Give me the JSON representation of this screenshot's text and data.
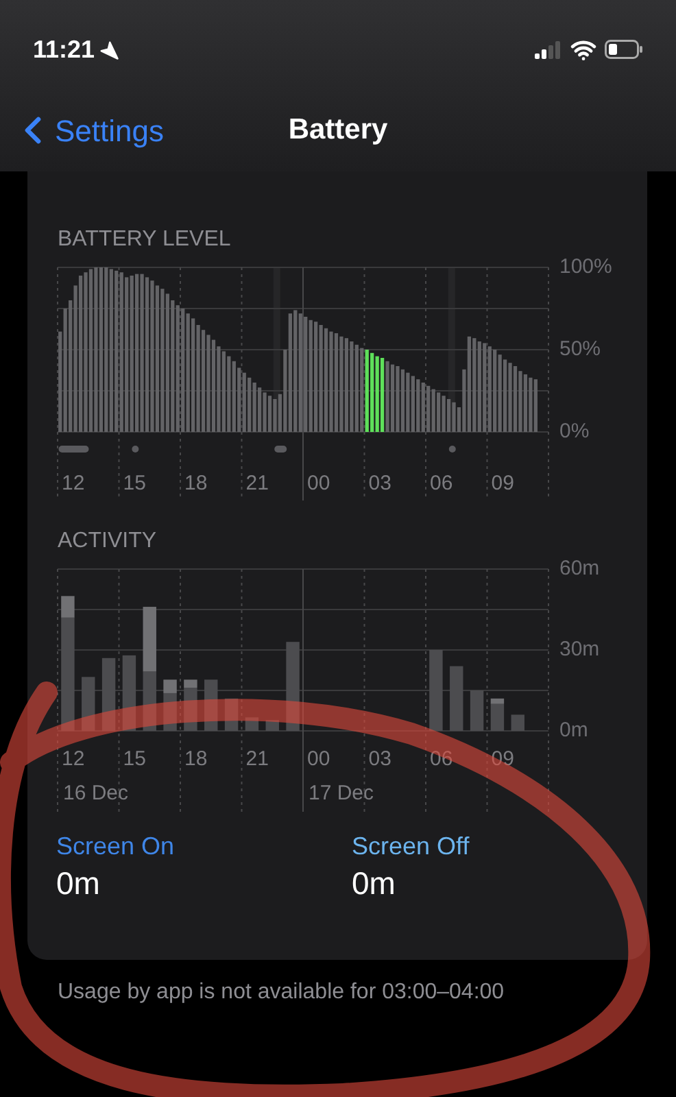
{
  "status_bar": {
    "time": "11:21"
  },
  "nav": {
    "back": "Settings",
    "title": "Battery"
  },
  "battery_chart": {
    "chart_data": {
      "type": "bar",
      "title": "BATTERY LEVEL",
      "ylim": [
        0,
        100
      ],
      "categories": [
        null,
        null,
        null,
        "12",
        null,
        null,
        null,
        null,
        null,
        null,
        null,
        null,
        null,
        null,
        null,
        "15",
        null,
        null,
        null,
        null,
        null,
        null,
        null,
        null,
        null,
        null,
        null,
        "18",
        null,
        null,
        null,
        null,
        null,
        null,
        null,
        null,
        null,
        null,
        null,
        "21",
        null,
        null,
        null,
        null,
        null,
        null,
        null,
        null,
        null,
        null,
        null,
        "00",
        null,
        null,
        null,
        null,
        null,
        null,
        null,
        null,
        null,
        null,
        null,
        "03",
        null,
        null,
        null,
        null,
        null,
        null,
        null,
        null,
        null,
        null,
        null,
        "06",
        null,
        null,
        null,
        null,
        null,
        null,
        null,
        null,
        null,
        null,
        null,
        "09",
        null,
        null,
        null,
        null,
        null,
        null,
        null,
        null
      ],
      "series": [
        {
          "color": "#636366",
          "values": [
            61,
            75,
            80,
            89,
            95,
            97,
            99,
            100,
            100,
            100,
            99,
            98,
            97,
            94,
            95,
            96,
            96,
            94,
            92,
            89,
            87,
            84,
            80,
            77,
            75,
            72,
            69,
            65,
            62,
            59,
            56,
            52,
            49,
            46,
            43,
            39,
            36,
            33,
            30,
            27,
            24,
            22,
            20,
            23,
            50,
            72,
            74,
            72,
            70,
            68,
            67,
            65,
            63,
            61,
            60,
            58,
            57,
            55,
            53,
            51,
            null,
            null,
            null,
            null,
            43,
            41,
            40,
            38,
            36,
            34,
            32,
            30,
            28,
            26,
            24,
            22,
            20,
            18,
            15,
            38,
            58,
            57,
            55,
            54,
            52,
            50,
            47,
            44,
            42,
            40,
            37,
            35,
            33,
            32,
            null,
            null
          ]
        },
        {
          "color": "#5ee05a",
          "values": [
            null,
            null,
            null,
            null,
            null,
            null,
            null,
            null,
            null,
            null,
            null,
            null,
            null,
            null,
            null,
            null,
            null,
            null,
            null,
            null,
            null,
            null,
            null,
            null,
            null,
            null,
            null,
            null,
            null,
            null,
            null,
            null,
            null,
            null,
            null,
            null,
            null,
            null,
            null,
            null,
            null,
            null,
            null,
            null,
            null,
            null,
            null,
            null,
            null,
            null,
            null,
            null,
            null,
            null,
            null,
            null,
            null,
            null,
            null,
            null,
            50,
            48,
            46,
            45,
            null,
            null,
            null,
            null,
            null,
            null,
            null,
            null,
            null,
            null,
            null,
            null,
            null,
            null,
            null,
            null,
            null,
            null,
            null,
            null,
            null,
            null,
            null,
            null,
            null,
            null,
            null,
            null,
            null,
            null,
            null,
            null
          ]
        }
      ],
      "yticks": [
        {
          "value": 0,
          "label": "0%"
        },
        {
          "value": 50,
          "label": "50%"
        },
        {
          "value": 100,
          "label": "100%"
        }
      ]
    }
  },
  "activity_chart": {
    "chart_data": {
      "type": "bar",
      "title": "ACTIVITY",
      "stacked": true,
      "ylim": [
        0,
        60
      ],
      "categories": [
        "12",
        null,
        null,
        "15",
        null,
        null,
        "18",
        null,
        null,
        "21",
        null,
        null,
        "00",
        null,
        null,
        "03",
        null,
        null,
        "06",
        null,
        null,
        "09",
        null,
        null
      ],
      "series": [
        {
          "name": "Screen On",
          "color": "#4c4c4f",
          "values": [
            42,
            20,
            27,
            28,
            22,
            14,
            16,
            19,
            12,
            5,
            4,
            33,
            0,
            0,
            0,
            0,
            0,
            0,
            30,
            24,
            15,
            10,
            6,
            0
          ]
        },
        {
          "name": "Screen Off",
          "color": "#717174",
          "values": [
            8,
            0,
            0,
            0,
            24,
            5,
            3,
            0,
            0,
            0,
            0,
            0,
            0,
            0,
            0,
            0,
            0,
            0,
            0,
            0,
            0,
            2,
            0,
            0
          ]
        }
      ],
      "yticks": [
        {
          "value": 0,
          "label": "0m"
        },
        {
          "value": 30,
          "label": "30m"
        },
        {
          "value": 60,
          "label": "60m"
        }
      ],
      "annotations": [
        "16 Dec",
        "17 Dec"
      ]
    }
  },
  "summary": [
    {
      "value": "0m",
      "color": "#3f86e8"
    },
    {
      "value": "0m",
      "color": "#6cb4ee"
    }
  ],
  "footnote": "Usage by app is not available for 03:00–04:00"
}
